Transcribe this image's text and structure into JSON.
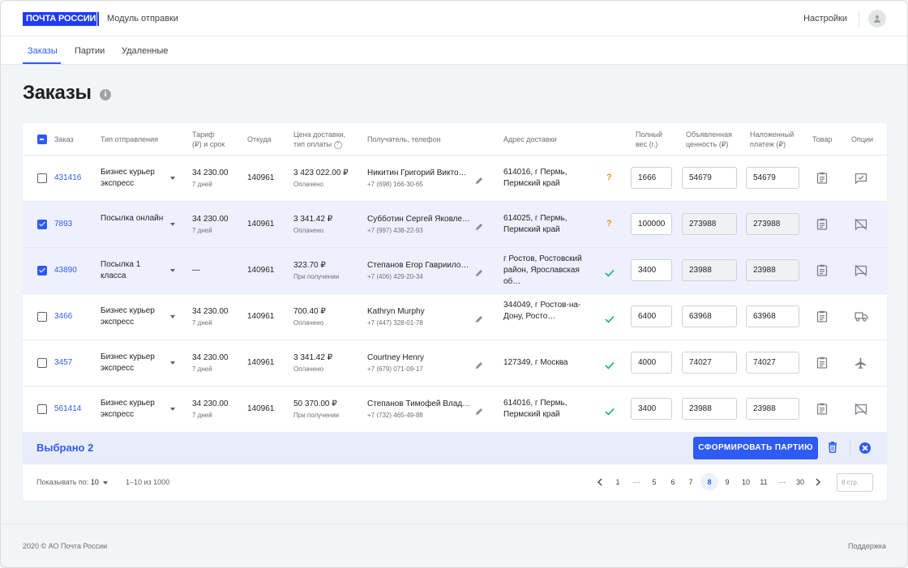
{
  "header": {
    "logo": "ПОЧТА РОССИИ",
    "module_title": "Модуль отправки",
    "settings": "Настройки"
  },
  "tabs": [
    {
      "label": "Заказы",
      "active": true
    },
    {
      "label": "Партии",
      "active": false
    },
    {
      "label": "Удаленные",
      "active": false
    }
  ],
  "page_title": "Заказы",
  "table": {
    "headers": {
      "order": "Заказ",
      "ship_type": "Тип отправления",
      "tariff": "Тариф\n(₽) и срок",
      "from": "Откуда",
      "price": "Цена доставки,\nтип оплаты",
      "recipient": "Получатель, телефон",
      "address": "Адрес доставки",
      "weight": "Полный\nвес (г.)",
      "declared": "Объявленная\nценность (₽)",
      "cod": "Наложенный\nплатеж (₽)",
      "goods": "Товар",
      "options": "Опции"
    },
    "rows": [
      {
        "selected": false,
        "order": "431416",
        "ship_type": "Бизнес курьер экспресс",
        "tariff": "34 230.00",
        "term": "7 дней",
        "from": "140961",
        "price": "3 423 022.00 ₽",
        "payment": "Оплачено",
        "recipient": "Никитин Григорий Викто…",
        "phone": "+7 (698) 166-30-65",
        "address": "614016, г Пермь, Пермский край",
        "status": "question",
        "weight": "1666",
        "declared": "54679",
        "cod": "54679",
        "inputs_disabled": false,
        "option_icon": "checked-comment-icon"
      },
      {
        "selected": true,
        "order": "7893",
        "ship_type": "Посылка онлайн",
        "tariff": "34 230.00",
        "term": "7 дней",
        "from": "140961",
        "price": "3 341.42 ₽",
        "payment": "Оплачено",
        "recipient": "Субботин Сергей Яковле…",
        "phone": "+7 (997) 438-22-93",
        "address": "614025, г Пермь, Пермский край",
        "status": "question",
        "weight": "100000",
        "declared": "273988",
        "cod": "273988",
        "inputs_disabled": true,
        "option_icon": "no-comment-icon"
      },
      {
        "selected": true,
        "order": "43890",
        "ship_type": "Посылка 1 класса",
        "tariff": "—",
        "term": "",
        "from": "140961",
        "price": "323.70 ₽",
        "payment": "При получении",
        "recipient": "Степанов Егор Гавриило…",
        "phone": "+7 (406) 429-20-34",
        "address": "г Ростов, Ростовский район, Ярославская об…",
        "status": "ok",
        "weight": "3400",
        "declared": "23988",
        "cod": "23988",
        "inputs_disabled": true,
        "option_icon": "no-comment-icon"
      },
      {
        "selected": false,
        "order": "3466",
        "ship_type": "Бизнес курьер экспресс",
        "tariff": "34 230.00",
        "term": "7 дней",
        "from": "140961",
        "price": "700.40 ₽",
        "payment": "Оплачено",
        "recipient": "Kathryn Murphy",
        "phone": "+7 (447) 328-01-78",
        "address": "344049, г Ростов-на-Дону, Росто…",
        "status": "ok",
        "weight": "6400",
        "declared": "63968",
        "cod": "63968",
        "inputs_disabled": false,
        "option_icon": "truck-icon"
      },
      {
        "selected": false,
        "order": "3457",
        "ship_type": "Бизнес курьер экспресс",
        "tariff": "34 230.00",
        "term": "7 дней",
        "from": "140961",
        "price": "3 341.42 ₽",
        "payment": "Оплачено",
        "recipient": "Courtney Henry",
        "phone": "+7 (679) 071-09-17",
        "address": "127349, г Москва",
        "status": "ok",
        "weight": "4000",
        "declared": "74027",
        "cod": "74027",
        "inputs_disabled": false,
        "option_icon": "airplane-icon"
      },
      {
        "selected": false,
        "order": "561414",
        "ship_type": "Бизнес курьер экспресс",
        "tariff": "34 230.00",
        "term": "7 дней",
        "from": "140961",
        "price": "50 370.00 ₽",
        "payment": "При получении",
        "recipient": "Степанов Тимофей Влад…",
        "phone": "+7 (732) 465-49-88",
        "address": "614016, г Пермь, Пермский край",
        "status": "ok",
        "weight": "3400",
        "declared": "23988",
        "cod": "23988",
        "inputs_disabled": false,
        "option_icon": "no-comment-icon"
      }
    ]
  },
  "selection": {
    "label": "Выбрано 2",
    "form_button": "СФОРМИРОВАТЬ ПАРТИЮ"
  },
  "pagination": {
    "show_label": "Показывать по:",
    "per_page": "10",
    "range": "1–10 из 1000",
    "pages": [
      "1",
      "···",
      "5",
      "6",
      "7",
      "8",
      "9",
      "10",
      "11",
      "···",
      "30"
    ],
    "active_page": "8",
    "goto_placeholder": "8 стр."
  },
  "footer": {
    "copyright": "2020 © АО Почта России",
    "support": "Поддержка"
  },
  "colors": {
    "accent": "#2e5bf5",
    "logo_bg": "#1f3cf5",
    "selected_row": "#eef1fd",
    "warning": "#f0901b",
    "success": "#2bb673"
  }
}
